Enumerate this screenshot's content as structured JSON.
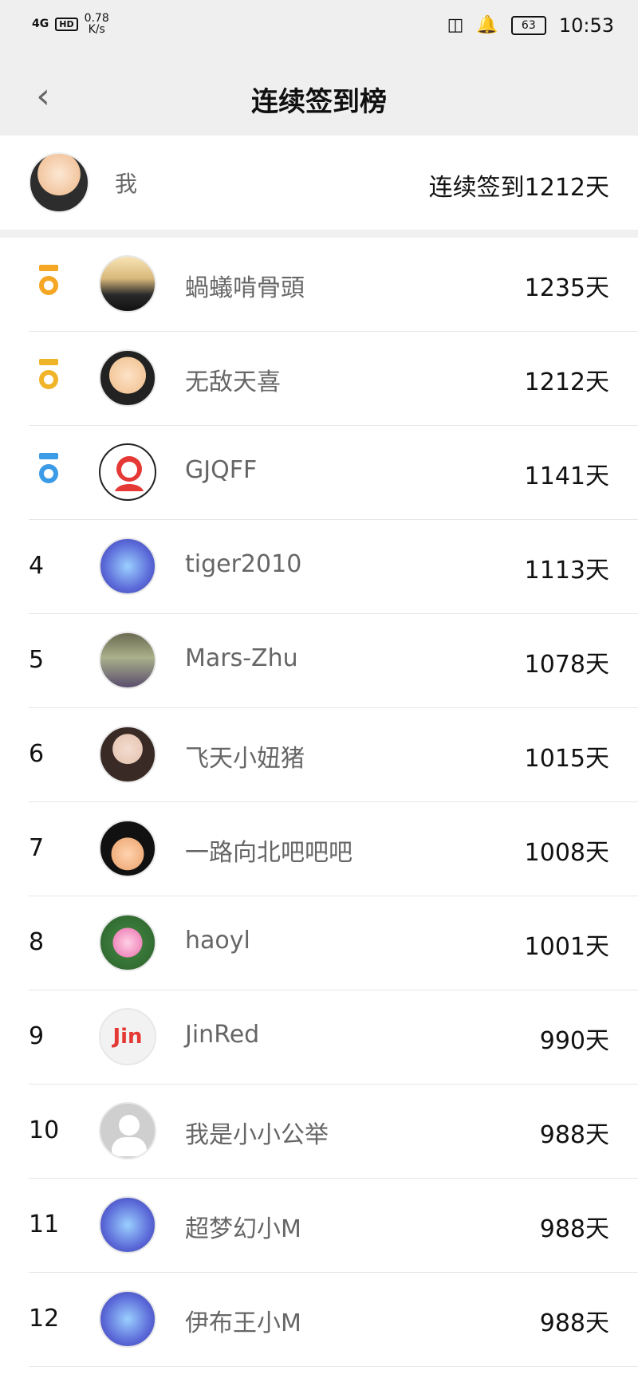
{
  "status_bar": {
    "signal": "4G",
    "hd": "HD",
    "speed_value": "0.78",
    "speed_unit": "K/s",
    "battery": "63",
    "time": "10:53",
    "icons": [
      "dolby-icon",
      "bell-icon",
      "battery-icon"
    ]
  },
  "header": {
    "title": "连续签到榜",
    "back_icon": "chevron-left-icon"
  },
  "me": {
    "name": "我",
    "streak_text": "连续签到1212天"
  },
  "leaderboard": [
    {
      "rank": "",
      "medal": "gold",
      "name": "蝸蟻啃骨頭",
      "days": "1235天"
    },
    {
      "rank": "",
      "medal": "silver",
      "name": "无敌天喜",
      "days": "1212天"
    },
    {
      "rank": "",
      "medal": "bronze",
      "name": "GJQFF",
      "days": "1141天"
    },
    {
      "rank": "4",
      "medal": "",
      "name": "tiger2010",
      "days": "1113天"
    },
    {
      "rank": "5",
      "medal": "",
      "name": "Mars-Zhu",
      "days": "1078天"
    },
    {
      "rank": "6",
      "medal": "",
      "name": "飞天小妞猪",
      "days": "1015天"
    },
    {
      "rank": "7",
      "medal": "",
      "name": "一路向北吧吧吧",
      "days": "1008天"
    },
    {
      "rank": "8",
      "medal": "",
      "name": "haoyl",
      "days": "1001天"
    },
    {
      "rank": "9",
      "medal": "",
      "name": "JinRed",
      "days": "990天"
    },
    {
      "rank": "10",
      "medal": "",
      "name": "我是小小公举",
      "days": "988天"
    },
    {
      "rank": "11",
      "medal": "",
      "name": "超梦幻小M",
      "days": "988天"
    },
    {
      "rank": "12",
      "medal": "",
      "name": "伊布王小M",
      "days": "988天"
    }
  ],
  "avatar_brand": {
    "jin_text": "Jin"
  },
  "colors": {
    "gold": "#f5a623",
    "silver": "#f0b429",
    "bronze": "#3b9be6",
    "jin_red": "#e53935"
  }
}
